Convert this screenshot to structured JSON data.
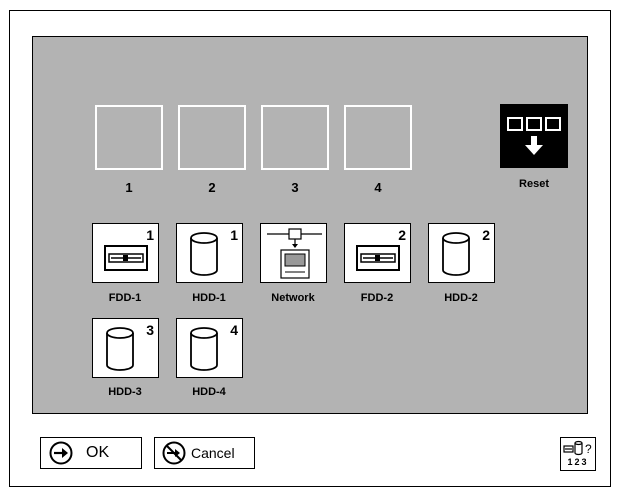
{
  "colors": {
    "panel_bg": "#b3b3b3",
    "slot_border": "#ffffff"
  },
  "boot_sequence": {
    "slots": [
      {
        "label": "1"
      },
      {
        "label": "2"
      },
      {
        "label": "3"
      },
      {
        "label": "4"
      }
    ],
    "reset": {
      "label": "Reset",
      "icon": "reset-icon"
    }
  },
  "devices": [
    {
      "label": "FDD-1",
      "badge": "1",
      "icon": "floppy-drive-icon"
    },
    {
      "label": "HDD-1",
      "badge": "1",
      "icon": "hard-disk-icon"
    },
    {
      "label": "Network",
      "badge": "",
      "icon": "network-icon"
    },
    {
      "label": "FDD-2",
      "badge": "2",
      "icon": "floppy-drive-icon"
    },
    {
      "label": "HDD-2",
      "badge": "2",
      "icon": "hard-disk-icon"
    },
    {
      "label": "HDD-3",
      "badge": "3",
      "icon": "hard-disk-icon"
    },
    {
      "label": "HDD-4",
      "badge": "4",
      "icon": "hard-disk-icon"
    }
  ],
  "footer": {
    "ok_label": "OK",
    "cancel_label": "Cancel",
    "help": {
      "icon": "device-help-icon",
      "numbers": "123"
    }
  }
}
